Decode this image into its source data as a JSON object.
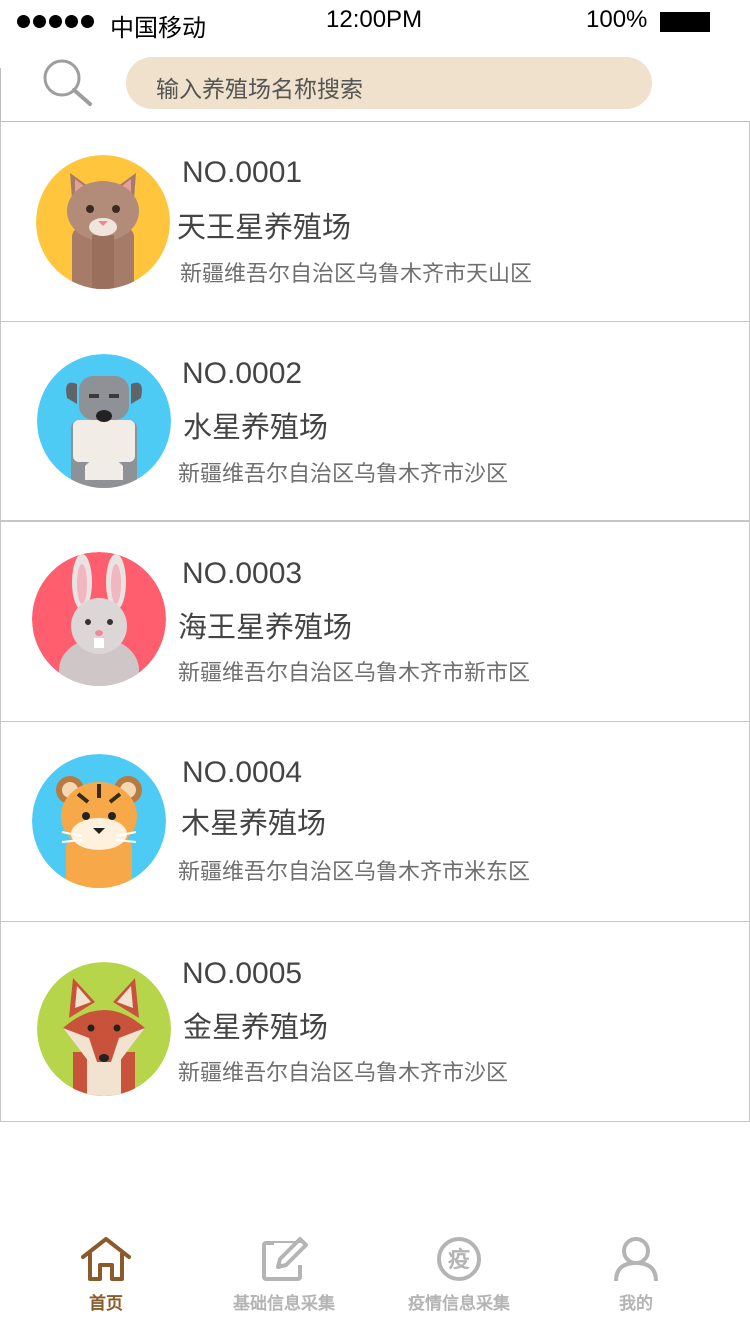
{
  "status_bar": {
    "carrier": "中国移动",
    "time": "12:00PM",
    "battery": "100%"
  },
  "search": {
    "placeholder": "输入养殖场名称搜索"
  },
  "farms": [
    {
      "no": "NO.0001",
      "name": "天王星养殖场",
      "address": "新疆维吾尔自治区乌鲁木齐市天山区",
      "avatar": "cat-avatar",
      "avatar_bg": "#fec53d"
    },
    {
      "no": "NO.0002",
      "name": "水星养殖场",
      "address": "新疆维吾尔自治区乌鲁木齐市沙区",
      "avatar": "dog-avatar",
      "avatar_bg": "#4dcbf5"
    },
    {
      "no": "NO.0003",
      "name": "海王星养殖场",
      "address": "新疆维吾尔自治区乌鲁木齐市新市区",
      "avatar": "rabbit-avatar",
      "avatar_bg": "#fe5e6e"
    },
    {
      "no": "NO.0004",
      "name": "木星养殖场",
      "address": "新疆维吾尔自治区乌鲁木齐市米东区",
      "avatar": "tiger-avatar",
      "avatar_bg": "#4dcbf5"
    },
    {
      "no": "NO.0005",
      "name": "金星养殖场",
      "address": "新疆维吾尔自治区乌鲁木齐市沙区",
      "avatar": "fox-avatar",
      "avatar_bg": "#b7d54a"
    }
  ],
  "tabs": [
    {
      "label": "首页",
      "icon": "home-icon",
      "active": true
    },
    {
      "label": "基础信息采集",
      "icon": "edit-icon",
      "active": false
    },
    {
      "label": "疫情信息采集",
      "icon": "epidemic-icon",
      "icon_text": "疫",
      "active": false
    },
    {
      "label": "我的",
      "icon": "user-icon",
      "active": false
    }
  ],
  "colors": {
    "tab_active": "#8a5a2b",
    "tab_inactive": "#b4b4b4",
    "search_bg": "#efe1cc"
  }
}
